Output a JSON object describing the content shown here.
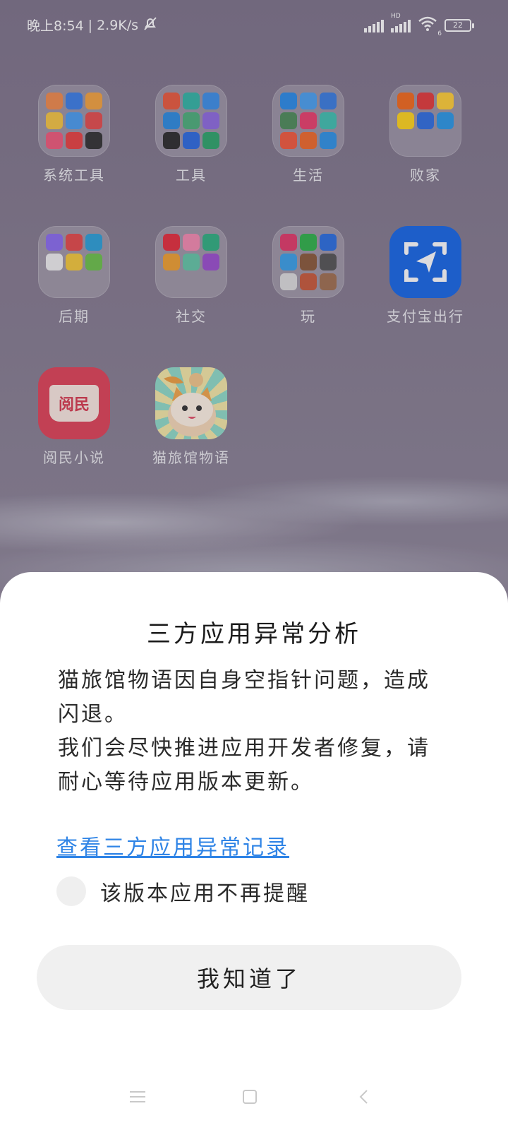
{
  "status_bar": {
    "time": "晚上8:54",
    "net_speed": "2.9K/s",
    "separator": "|",
    "hd_label": "HD",
    "wifi_badge": "6",
    "battery": "22"
  },
  "home": {
    "folders_row1": [
      {
        "label": "系统工具",
        "colors": [
          "#f08a4b",
          "#3b7ee6",
          "#f3a33d",
          "#f5c542",
          "#4a9df0",
          "#e44c4c",
          "#ef5a7a",
          "#e84141",
          "#333333"
        ]
      },
      {
        "label": "工具",
        "colors": [
          "#e95a3c",
          "#33b5a5",
          "#3c8fe8",
          "#2d8be0",
          "#4caf7a",
          "#8e6be0",
          "#2c2c2c",
          "#2d6be0",
          "#2ea56b"
        ]
      },
      {
        "label": "生活",
        "colors": [
          "#2a8be8",
          "#4aa0ef",
          "#3a7de0",
          "#4d8c5a",
          "#ea3f6c",
          "#40c0b0",
          "#f25a3c",
          "#ef6a2a",
          "#2f93e6"
        ]
      },
      {
        "label": "败家",
        "colors": [
          "#f26a1b",
          "#e23a3a",
          "#ffcf36",
          "#ffd51c",
          "#2f6ee0",
          "#2a98e6",
          "transparent",
          "transparent",
          "transparent"
        ]
      }
    ],
    "folders_row2": [
      {
        "label": "后期",
        "colors": [
          "#8a6cf0",
          "#e44a4a",
          "#2ba0d8",
          "#f0f0f0",
          "#f5c83a",
          "#6cc24a",
          "transparent",
          "transparent",
          "transparent"
        ]
      },
      {
        "label": "社交",
        "colors": [
          "#e42e3c",
          "#f58ab0",
          "#2fb080",
          "#f0a030",
          "#63c6a6",
          "#9b4fcf",
          "transparent",
          "transparent",
          "transparent"
        ]
      },
      {
        "label": "玩",
        "colors": [
          "#e23a6a",
          "#2fb34a",
          "#2a6ee0",
          "#3aa0e8",
          "#8a5a3a",
          "#555555",
          "#ddd",
          "#c95a3a",
          "#a07050"
        ]
      }
    ],
    "apps": [
      {
        "label": "支付宝出行",
        "icon": "alipay-travel-icon",
        "color": "#1767e6"
      },
      {
        "label": "阅民小说",
        "icon": "book-icon",
        "color": "#e04357",
        "badge_text": "阅民"
      },
      {
        "label": "猫旅馆物语",
        "icon": "cat-hotel-icon",
        "color": "#7fd1c0"
      }
    ]
  },
  "dialog": {
    "title": "三方应用异常分析",
    "line1": "猫旅馆物语因自身空指针问题，造成闪退。",
    "line2": "我们会尽快推进应用开发者修复，请耐心等待应用版本更新。",
    "link": "查看三方应用异常记录",
    "checkbox_label": "该版本应用不再提醒",
    "button": "我知道了"
  },
  "navbar": {
    "menu_icon": "menu-icon",
    "home_icon": "home-icon",
    "back_icon": "back-icon"
  }
}
